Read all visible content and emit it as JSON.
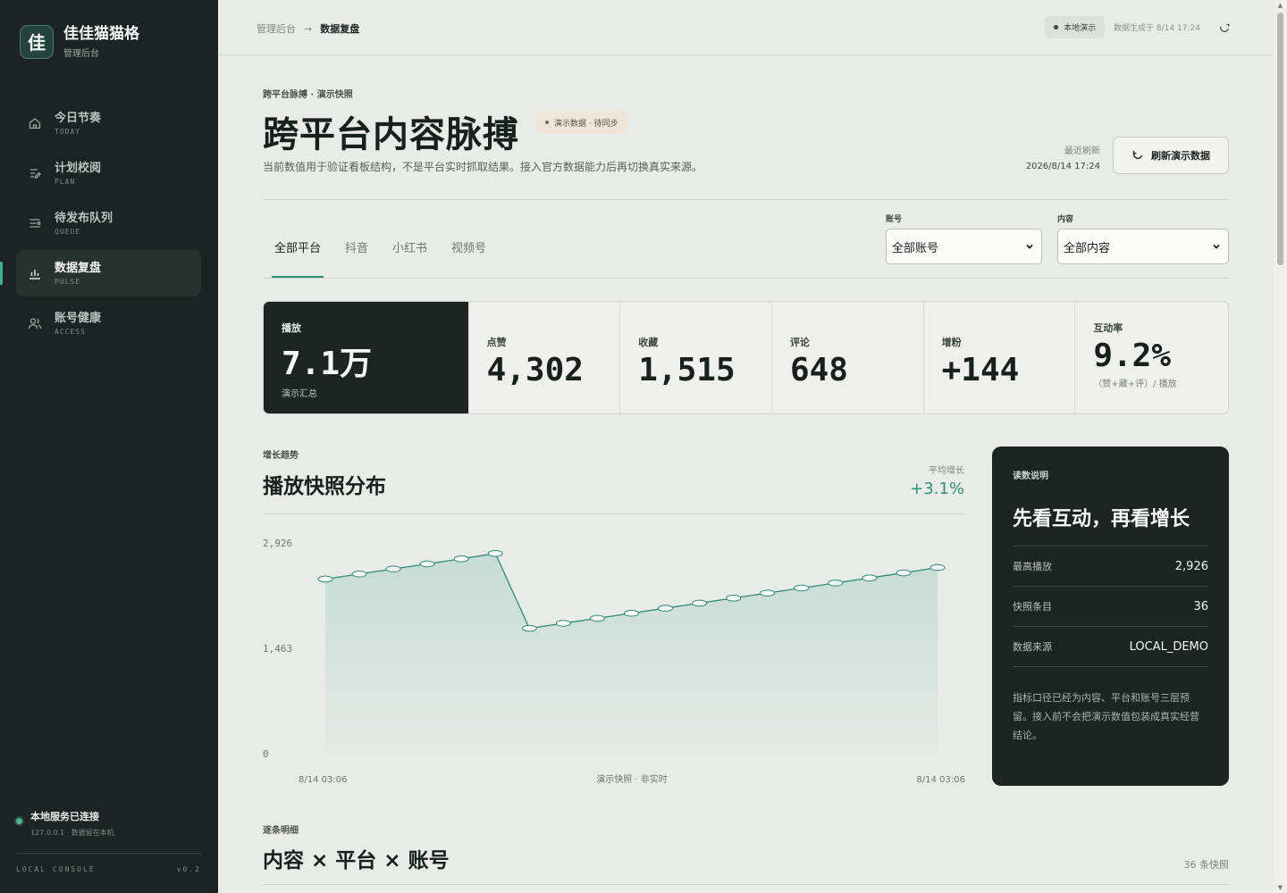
{
  "brand": {
    "logo_char": "佳",
    "name": "佳佳猫猫格",
    "subtitle": "管理后台"
  },
  "nav": [
    {
      "label": "今日节奏",
      "sub": "TODAY",
      "icon": "home-icon",
      "active": false
    },
    {
      "label": "计划校阅",
      "sub": "PLAN",
      "icon": "plan-icon",
      "active": false
    },
    {
      "label": "待发布队列",
      "sub": "QUEUE",
      "icon": "queue-icon",
      "active": false
    },
    {
      "label": "数据复盘",
      "sub": "PULSE",
      "icon": "bar-chart-icon",
      "active": true
    },
    {
      "label": "账号健康",
      "sub": "ACCESS",
      "icon": "users-icon",
      "active": false
    }
  ],
  "server": {
    "title": "本地服务已连接",
    "detail": "127.0.0.1 · 数据留在本机"
  },
  "console": {
    "left": "LOCAL CONSOLE",
    "right": "v0.2"
  },
  "breadcrumb": {
    "root": "管理后台",
    "sep": "→",
    "current": "数据复盘"
  },
  "topbar": {
    "demo_pill": "本地演示",
    "generated": "数据生成于 8/14 17:24"
  },
  "hero": {
    "eyebrow": "跨平台脉搏 · 演示快照",
    "title": "跨平台内容脉搏",
    "badge": "演示数据 · 待同步",
    "description": "当前数值用于验证看板结构，不是平台实时抓取结果。接入官方数据能力后再切换真实来源。",
    "last_refresh_label": "最近刷新",
    "last_refresh_value": "2026/8/14 17:24",
    "refresh_button": "刷新演示数据"
  },
  "tabs": [
    "全部平台",
    "抖音",
    "小红书",
    "视频号"
  ],
  "filters": {
    "account": {
      "label": "账号",
      "value": "全部账号"
    },
    "content": {
      "label": "内容",
      "value": "全部内容"
    }
  },
  "stats": [
    {
      "label": "播放",
      "value": "7.1万",
      "note": "演示汇总"
    },
    {
      "label": "点赞",
      "value": "4,302",
      "note": ""
    },
    {
      "label": "收藏",
      "value": "1,515",
      "note": ""
    },
    {
      "label": "评论",
      "value": "648",
      "note": ""
    },
    {
      "label": "增粉",
      "value": "+144",
      "note": ""
    },
    {
      "label": "互动率",
      "value": "9.2%",
      "note": "（赞+藏+评）/ 播放"
    }
  ],
  "trend": {
    "eyebrow": "增长趋势",
    "title": "播放快照分布",
    "avg_growth_label": "平均增长",
    "avg_growth_value": "+3.1%",
    "x_start": "8/14 03:06",
    "x_mid": "演示快照 · 非实时",
    "x_end": "8/14 03:06"
  },
  "chart_data": {
    "type": "area",
    "ylim": [
      0,
      2926
    ],
    "y_ticks": [
      "0",
      "1,463",
      "2,926"
    ],
    "values": [
      2425,
      2495,
      2565,
      2635,
      2705,
      2780,
      1740,
      1810,
      1880,
      1950,
      2020,
      2090,
      2160,
      2230,
      2300,
      2370,
      2440,
      2510,
      2585
    ],
    "colors": {
      "line": "#2f8a75",
      "fill_top": "#c5dcd5",
      "fill_bottom": "#e6e9e6"
    }
  },
  "info_card": {
    "eyebrow": "读数说明",
    "title": "先看互动，再看增长",
    "rows": [
      {
        "key": "最高播放",
        "value": "2,926"
      },
      {
        "key": "快照条目",
        "value": "36"
      },
      {
        "key": "数据来源",
        "value": "LOCAL_DEMO"
      }
    ],
    "note": "指标口径已经为内容、平台和账号三层预留。接入前不会把演示数值包装成真实经营结论。"
  },
  "detail": {
    "eyebrow": "逐条明细",
    "title": "内容 × 平台 × 账号",
    "count": "36 条快照"
  }
}
